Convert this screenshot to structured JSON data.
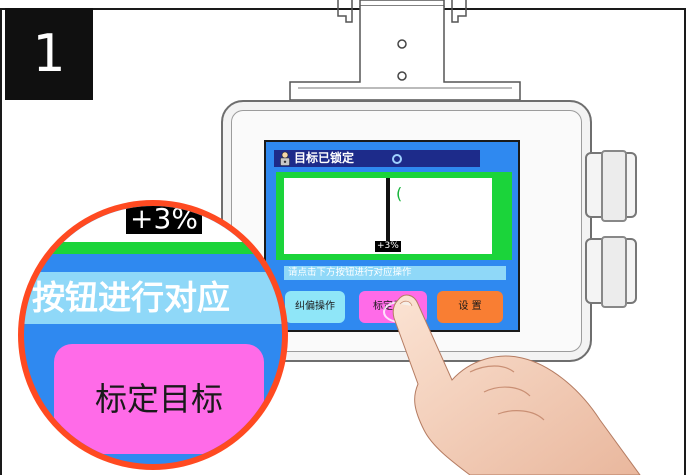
{
  "step": {
    "number": "1"
  },
  "screen": {
    "title": "目标已锁定",
    "target_value": "+3%",
    "bracket_char": "(",
    "prompt": "请点击下方按钮进行对应操作",
    "buttons": {
      "correct": "纠偏操作",
      "calibrate": "标定目标",
      "settings": "设 置"
    }
  },
  "magnifier": {
    "value": "+3%",
    "prompt": "按钮进行对应",
    "button": "标定目标"
  },
  "colors": {
    "screen_bg": "#2f89f0",
    "title_bar": "#1d2b8a",
    "chart_frame": "#1bd43a",
    "prompt_bar": "#8fd8f8",
    "correct_button": "#8fe6f8",
    "calibrate_button": "#ff6be8",
    "settings_button": "#f97e33",
    "magnifier_ring": "#ff4a21"
  },
  "icons": [
    "lock-status-icon",
    "status-dot-icon",
    "hand-pointer-icon"
  ]
}
